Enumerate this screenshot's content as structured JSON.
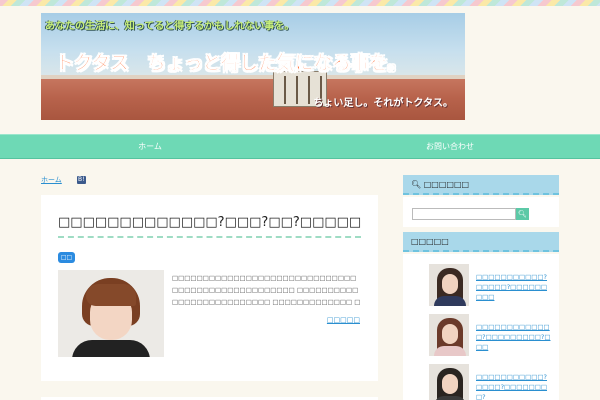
{
  "header": {
    "top_text": "あなたの生活に、知ってると得するかもしれない事を。",
    "title": "トクタス　ちょっと得した気になる事を。",
    "bottom_text": "ちょい足し。それがトクタス。"
  },
  "nav": {
    "items": [
      {
        "label": "ホーム"
      },
      {
        "label": "お問い合わせ"
      }
    ]
  },
  "breadcrumb": {
    "home": "ホーム",
    "rss": "B!"
  },
  "article": {
    "title": "□□□□□□□□□□□□□?□□□?□□?□□□□□□□□□?□□?",
    "category": "□□",
    "excerpt": "□□□□□□□□□□□□□□□□□□□□□□□□□□□□□□□□□□□□□□□□□□□□□□□□□□ □□□□□□□□□□□□□□□□□□□□□□□□□□ □□□□□□□□□□□□□ □□□□□□□□□ □□□□□□□[...]",
    "read_more": "□□□□□"
  },
  "sidebar": {
    "search": {
      "heading": "□□□□□□",
      "placeholder": "",
      "button_icon": "search-icon"
    },
    "recent": {
      "heading": "□□□□□",
      "posts": [
        {
          "title": "□□□□□□□□□□□?□□□□□?□□□□□□□□□"
        },
        {
          "title": "□□□□□□□□□□□□□?□□□□□□□□□?□□□"
        },
        {
          "title": "□□□□□□□□□□□?□□□□?□□□□□□□□?"
        }
      ]
    }
  },
  "colors": {
    "nav": "#6ed9b5",
    "link": "#2a8fd0",
    "widget_head": "#a9d8ea",
    "title_orange": "#ff5a1a"
  }
}
